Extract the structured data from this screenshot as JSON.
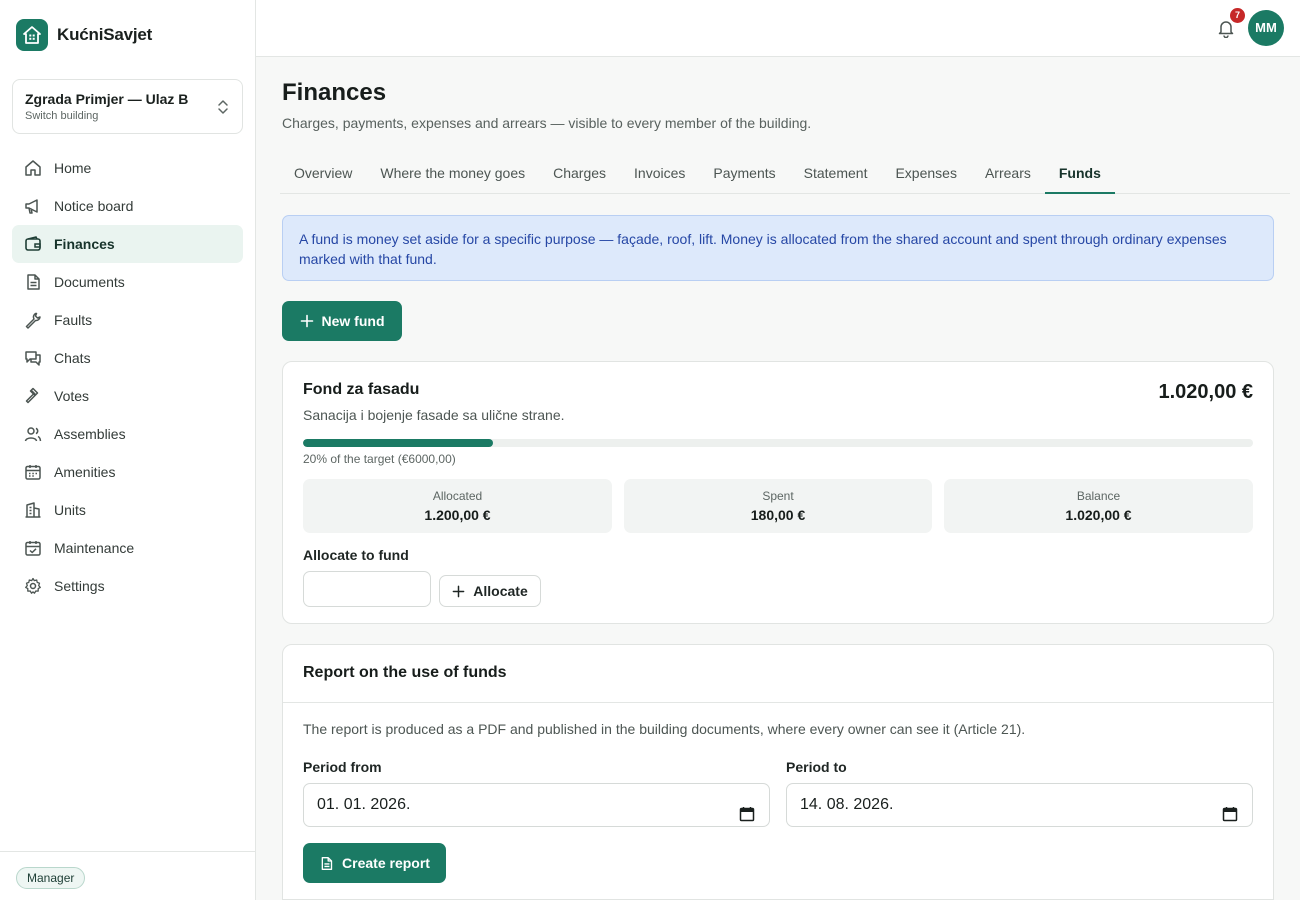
{
  "brand": {
    "name": "KućniSavjet"
  },
  "building": {
    "name": "Zgrada Primjer — Ulaz B",
    "switch_label": "Switch building"
  },
  "nav": [
    {
      "label": "Home",
      "icon": "home-icon",
      "active": false
    },
    {
      "label": "Notice board",
      "icon": "megaphone-icon",
      "active": false
    },
    {
      "label": "Finances",
      "icon": "wallet-icon",
      "active": true
    },
    {
      "label": "Documents",
      "icon": "document-icon",
      "active": false
    },
    {
      "label": "Faults",
      "icon": "wrench-icon",
      "active": false
    },
    {
      "label": "Chats",
      "icon": "chat-icon",
      "active": false
    },
    {
      "label": "Votes",
      "icon": "gavel-icon",
      "active": false
    },
    {
      "label": "Assemblies",
      "icon": "users-icon",
      "active": false
    },
    {
      "label": "Amenities",
      "icon": "calendar-icon",
      "active": false
    },
    {
      "label": "Units",
      "icon": "building-icon",
      "active": false
    },
    {
      "label": "Maintenance",
      "icon": "calendar-check-icon",
      "active": false
    },
    {
      "label": "Settings",
      "icon": "gear-icon",
      "active": false
    }
  ],
  "role": "Manager",
  "topbar": {
    "notifications_count": "7",
    "avatar_initials": "MM"
  },
  "page": {
    "title": "Finances",
    "description": "Charges, payments, expenses and arrears — visible to every member of the building."
  },
  "tabs": [
    {
      "label": "Overview",
      "active": false
    },
    {
      "label": "Where the money goes",
      "active": false
    },
    {
      "label": "Charges",
      "active": false
    },
    {
      "label": "Invoices",
      "active": false
    },
    {
      "label": "Payments",
      "active": false
    },
    {
      "label": "Statement",
      "active": false
    },
    {
      "label": "Expenses",
      "active": false
    },
    {
      "label": "Arrears",
      "active": false
    },
    {
      "label": "Funds",
      "active": true
    }
  ],
  "info_text": "A fund is money set aside for a specific purpose — façade, roof, lift. Money is allocated from the shared account and spent through ordinary expenses marked with that fund.",
  "new_fund_label": "New fund",
  "fund": {
    "name": "Fond za fasadu",
    "balance_display": "1.020,00 €",
    "description": "Sanacija i bojenje fasade sa ulične strane.",
    "progress_fraction": 0.2,
    "progress_label": "20% of the target (€6000,00)",
    "stats": [
      {
        "label": "Allocated",
        "value": "1.200,00 €"
      },
      {
        "label": "Spent",
        "value": "180,00 €"
      },
      {
        "label": "Balance",
        "value": "1.020,00 €"
      }
    ],
    "allocate_label": "Allocate to fund",
    "allocate_input_value": "",
    "allocate_button": "Allocate"
  },
  "report": {
    "title": "Report on the use of funds",
    "description": "The report is produced as a PDF and published in the building documents, where every owner can see it (Article 21).",
    "period_from_label": "Period from",
    "period_from_value": "01. 01. 2026.",
    "period_to_label": "Period to",
    "period_to_value": "14. 08. 2026.",
    "create_button": "Create report"
  },
  "colors": {
    "accent": "#1b7a64",
    "info_bg": "#dde9fb",
    "info_text": "#2647a5",
    "badge": "#c62828"
  }
}
